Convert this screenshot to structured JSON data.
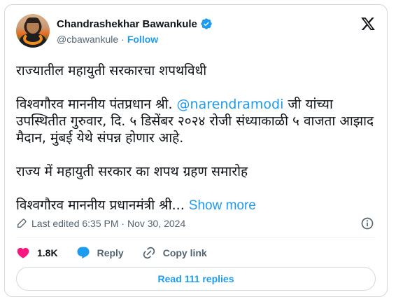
{
  "author": {
    "name": "Chandrashekhar Bawankule",
    "handle": "@cbawankule",
    "separator": "·",
    "follow_label": "Follow"
  },
  "tweet": {
    "line1": "राज्यातील महायुती सरकारचा शपथविधी",
    "p2_before": "विश्वगौरव माननीय पंतप्रधान श्री. ",
    "p2_mention": "@narendramodi",
    "p2_after": " जी यांच्या उपस्थितीत गुरुवार, दि. ५ डिसेंबर २०२४ रोजी संध्याकाळी ५ वाजता आझाद मैदान, मुंबई येथे संपन्न होणार आहे.",
    "line3": "राज्य में महायुती सरकार का शपथ ग्रहण समारोह",
    "line4": "विश्वगौरव माननीय प्रधानमंत्री श्री... ",
    "show_more": "Show more"
  },
  "meta": {
    "edited_text": "Last edited 6:35 PM · Nov 30, 2024"
  },
  "actions": {
    "likes": "1.8K",
    "reply_label": "Reply",
    "copy_link_label": "Copy link"
  },
  "replies_button": "Read 111 replies",
  "colors": {
    "accent": "#1d9bf0",
    "like": "#f91880",
    "text": "#0f1419",
    "muted": "#536471",
    "border": "#cfd9de"
  },
  "icons": [
    "verified-badge-icon",
    "x-logo-icon",
    "pencil-icon",
    "info-icon",
    "heart-icon",
    "reply-bubble-icon",
    "link-icon"
  ]
}
